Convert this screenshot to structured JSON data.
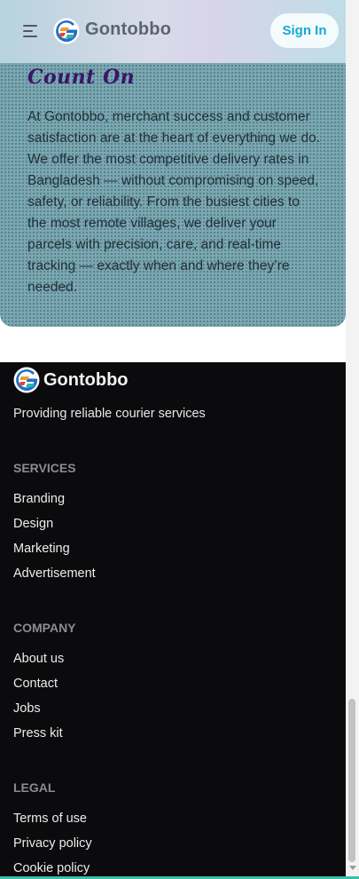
{
  "header": {
    "brand": "Gontobbo",
    "sign_in_label": "Sign In"
  },
  "hero": {
    "title": "Count On",
    "body": "At Gontobbo, merchant success and customer satisfaction are at the heart of everything we do. We offer the most competitive delivery rates in Bangladesh — without compromising on speed, safety, or reliability. From the busiest cities to the most remote villages, we deliver your parcels with precision, care, and real-time tracking — exactly when and where they’re needed."
  },
  "footer": {
    "brand": "Gontobbo",
    "tagline": "Providing reliable courier services",
    "sections": [
      {
        "heading": "SERVICES",
        "links": [
          "Branding",
          "Design",
          "Marketing",
          "Advertisement"
        ]
      },
      {
        "heading": "COMPANY",
        "links": [
          "About us",
          "Contact",
          "Jobs",
          "Press kit"
        ]
      },
      {
        "heading": "LEGAL",
        "links": [
          "Terms of use",
          "Privacy policy",
          "Cookie policy"
        ]
      }
    ]
  },
  "colors": {
    "accent": "#18a7d6",
    "hero_bg": "#79a7b2",
    "hero_title": "#3b1569",
    "footer_bg": "#0b0b0d"
  },
  "icons": {
    "menu": "hamburger-menu-icon",
    "logo": "gontobbo-logo-icon"
  }
}
